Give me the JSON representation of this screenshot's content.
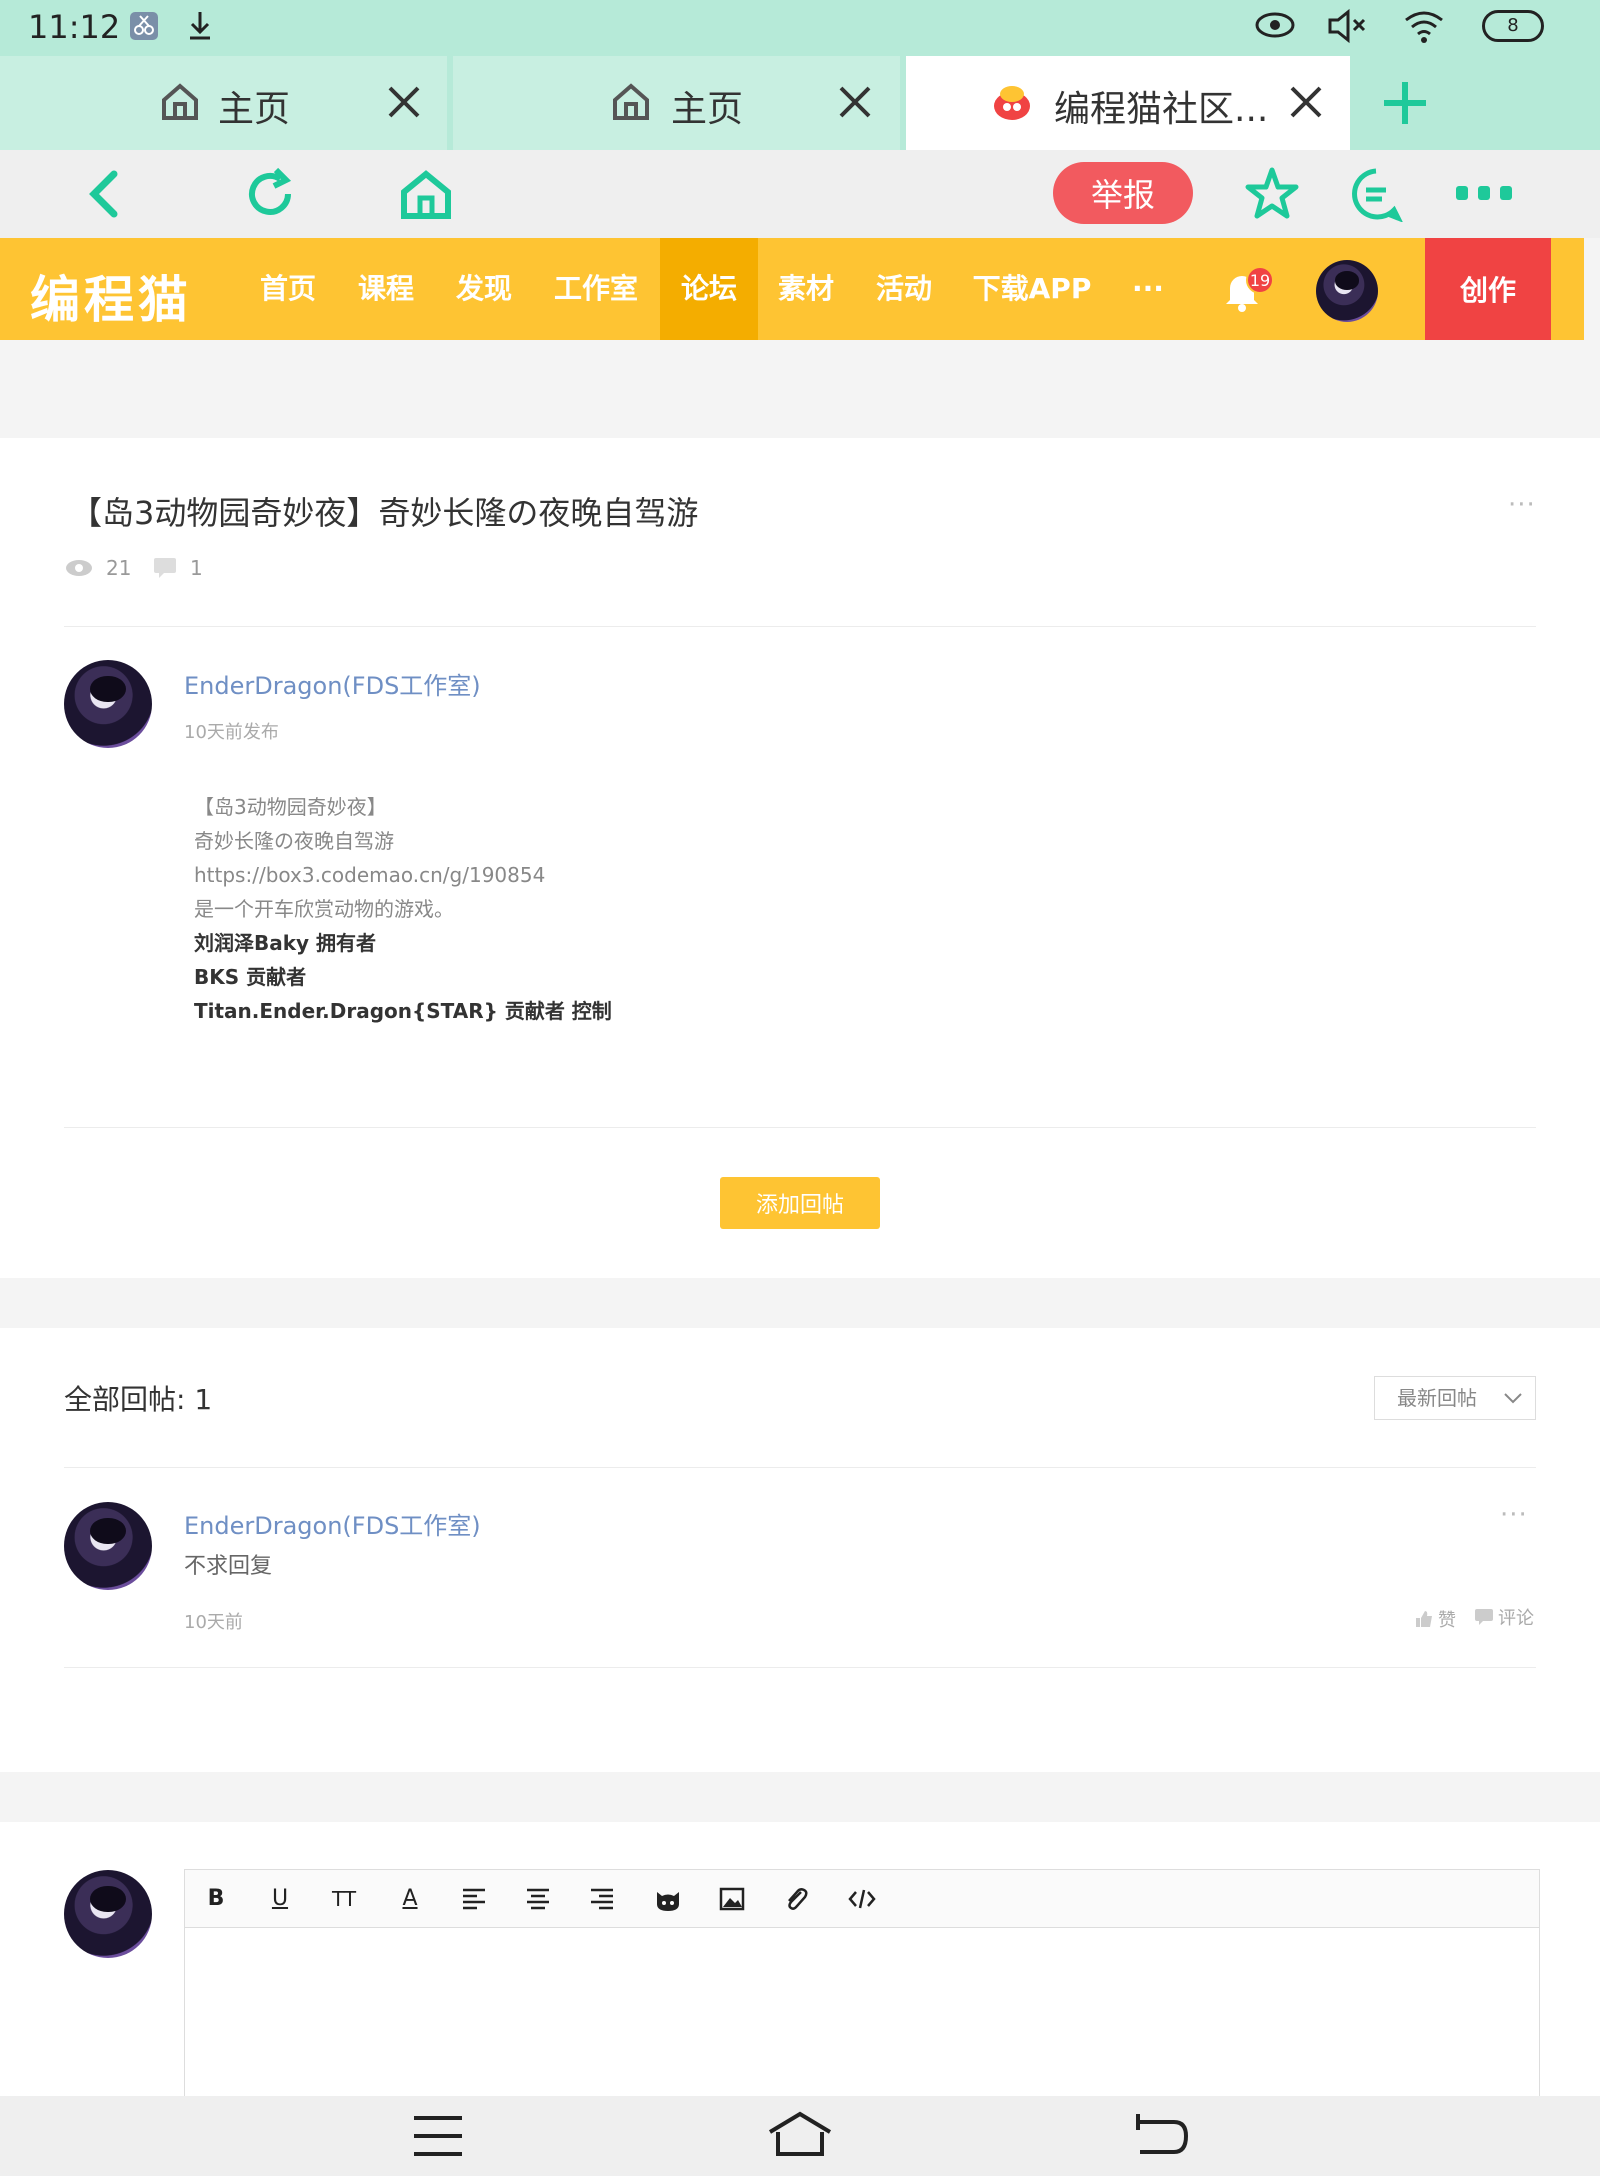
{
  "status_bar": {
    "time": "11:12",
    "battery": "8"
  },
  "tabs": [
    {
      "label": "主页",
      "icon": "home-icon"
    },
    {
      "label": "主页",
      "icon": "home-icon"
    },
    {
      "label": "编程猫社区...",
      "icon": "codemao-logo-icon"
    }
  ],
  "toolbar": {
    "report_label": "举报"
  },
  "site_nav": {
    "logo": "编程猫",
    "items": [
      "首页",
      "课程",
      "发现",
      "工作室",
      "论坛",
      "素材",
      "活动",
      "下载APP",
      "···"
    ],
    "active_item": "论坛",
    "notification_count": "19",
    "create_label": "创作"
  },
  "post": {
    "title": "【岛3动物园奇妙夜】奇妙长隆の夜晚自驾游",
    "views": "21",
    "comments": "1",
    "author": "EnderDragon(FDS工作室)",
    "time": "10天前发布",
    "content": [
      "【岛3动物园奇妙夜】",
      "奇妙长隆の夜晚自驾游",
      "https://box3.codemao.cn/g/190854",
      "是一个开车欣赏动物的游戏。"
    ],
    "content_bold": [
      "刘润泽Baky 拥有者",
      "BKS 贡献者",
      "Titan.Ender.Dragon{STAR} 贡献者 控制"
    ],
    "reply_button": "添加回帖"
  },
  "replies": {
    "header": "全部回帖: 1",
    "sort": "最新回帖",
    "items": [
      {
        "author": "EnderDragon(FDS工作室)",
        "text": "不求回复",
        "time": "10天前",
        "like": "赞",
        "comment": "评论"
      }
    ]
  },
  "colors": {
    "brand_yellow": "#fec433",
    "active_nav": "#f4ad00",
    "create_red": "#f04343",
    "accent_green": "#1ec99a",
    "author_blue": "#6f8fc4"
  }
}
